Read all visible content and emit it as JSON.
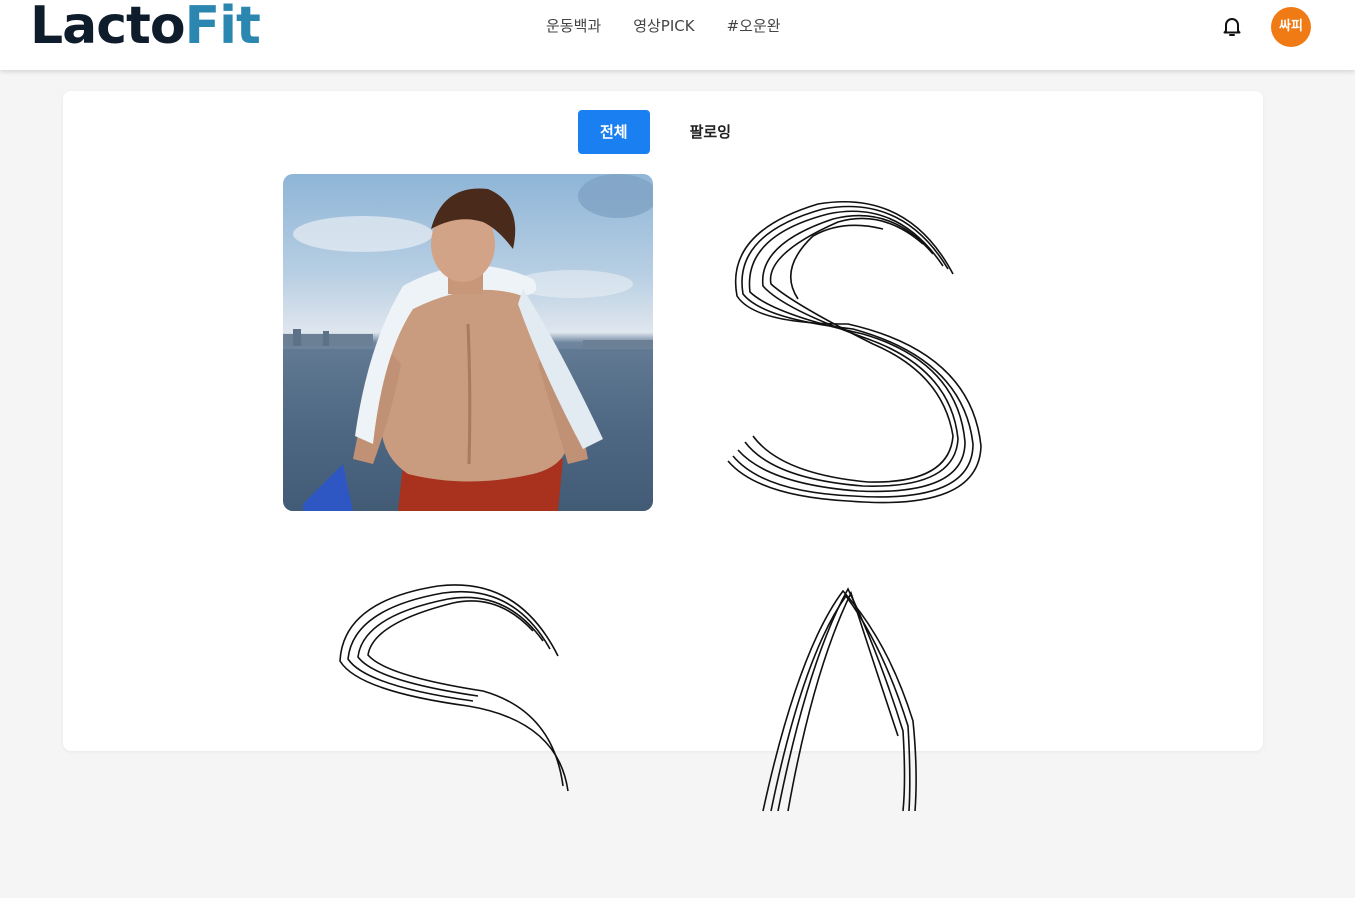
{
  "header": {
    "logo": {
      "part1": "Lacto",
      "part2": "Fit"
    },
    "nav": [
      "운동백과",
      "영상PICK",
      "#오운완"
    ],
    "notification_icon": "bell-icon",
    "avatar_label": "싸피",
    "avatar_color": "#f07a13"
  },
  "feed": {
    "tabs": [
      {
        "label": "전체",
        "active": true
      },
      {
        "label": "팔로잉",
        "active": false
      }
    ],
    "accent_color": "#1a7ff1",
    "posts": [
      {
        "kind": "photo",
        "description": ""
      },
      {
        "kind": "sketch"
      },
      {
        "kind": "sketch"
      },
      {
        "kind": "sketch"
      }
    ]
  }
}
